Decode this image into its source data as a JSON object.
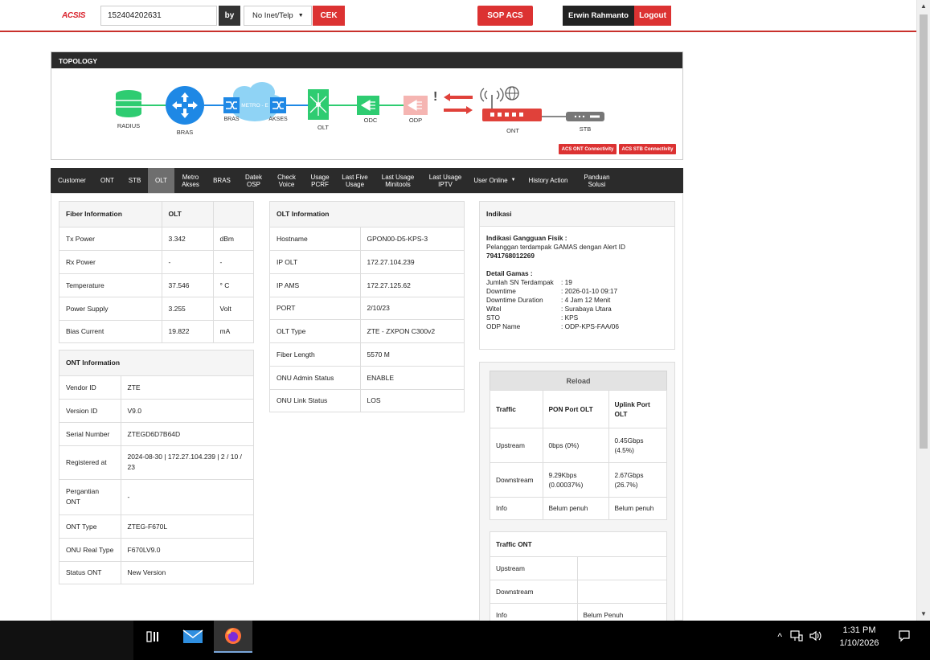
{
  "header": {
    "logo": "ACSIS",
    "search_value": "152404202631",
    "by_label": "by",
    "type_select": "No Inet/Telp",
    "cek_label": "CEK",
    "sop_label": "SOP ACS",
    "user_name": "Erwin Rahmanto",
    "logout_label": "Logout"
  },
  "topology": {
    "title": "TOPOLOGY",
    "nodes": {
      "radius": "RADIUS",
      "bras": "BRAS",
      "bras2": "BRAS",
      "metro": "METRO - E",
      "akses": "AKSES",
      "olt": "OLT",
      "odc": "ODC",
      "odp": "ODP",
      "ont": "ONT",
      "stb": "STB"
    },
    "alert_mark": "!",
    "btn_ont": "ACS ONT Connectivity",
    "btn_stb": "ACS STB Connectivity",
    "colors": {
      "green": "#2ecc71",
      "blue": "#1e88e5",
      "red": "#e0413a",
      "cloud": "#8fd3f5"
    }
  },
  "tabs": [
    {
      "label": "Customer"
    },
    {
      "label": "ONT"
    },
    {
      "label": "STB"
    },
    {
      "label": "OLT",
      "active": true
    },
    {
      "label": "Metro\nAkses"
    },
    {
      "label": "BRAS"
    },
    {
      "label": "Datek\nOSP"
    },
    {
      "label": "Check\nVoice"
    },
    {
      "label": "Usage\nPCRF"
    },
    {
      "label": "Last Five\nUsage"
    },
    {
      "label": "Last Usage\nMinitools"
    },
    {
      "label": "Last Usage\nIPTV"
    },
    {
      "label": "User Online",
      "dropdown": true
    },
    {
      "label": "History Action"
    },
    {
      "label": "Panduan\nSolusi"
    }
  ],
  "fiber": {
    "header": [
      "Fiber Information",
      "OLT",
      ""
    ],
    "rows": [
      [
        "Tx Power",
        "3.342",
        "dBm"
      ],
      [
        "Rx Power",
        "-",
        "-"
      ],
      [
        "Temperature",
        "37.546",
        "° C"
      ],
      [
        "Power Supply",
        "3.255",
        "Volt"
      ],
      [
        "Bias Current",
        "19.822",
        "mA"
      ]
    ]
  },
  "ont_info": {
    "title": "ONT Information",
    "rows": [
      [
        "Vendor ID",
        "ZTE"
      ],
      [
        "Version ID",
        "V9.0"
      ],
      [
        "Serial Number",
        "ZTEGD6D7B64D"
      ],
      [
        "Registered at",
        "2024-08-30 | 172.27.104.239 | 2 / 10 / 23"
      ],
      [
        "Pergantian ONT",
        "-"
      ],
      [
        "ONT Type",
        "ZTEG-F670L"
      ],
      [
        "ONU Real Type",
        "F670LV9.0"
      ],
      [
        "Status ONT",
        "New Version"
      ]
    ]
  },
  "olt_info": {
    "title": "OLT Information",
    "rows": [
      [
        "Hostname",
        "GPON00-D5-KPS-3"
      ],
      [
        "IP OLT",
        "172.27.104.239"
      ],
      [
        "IP AMS",
        "172.27.125.62"
      ],
      [
        "PORT",
        "2/10/23"
      ],
      [
        "OLT Type",
        "ZTE - ZXPON C300v2"
      ],
      [
        "Fiber Length",
        "5570 M"
      ],
      [
        "ONU Admin Status",
        "ENABLE"
      ],
      [
        "ONU Link Status",
        "LOS"
      ]
    ]
  },
  "indikasi": {
    "title": "Indikasi",
    "gangguan_title": "Indikasi Gangguan Fisik :",
    "gangguan_text": "Pelanggan terdampak GAMAS dengan Alert ID",
    "alert_id": "7941768012269",
    "detail_title": "Detail Gamas :",
    "details": [
      [
        "Jumlah SN Terdampak",
        ": 19"
      ],
      [
        "Downtime",
        ": 2026-01-10 09:17"
      ],
      [
        "Downtime Duration",
        ": 4 Jam 12 Menit"
      ],
      [
        "Witel",
        ": Surabaya Utara"
      ],
      [
        "STO",
        ": KPS"
      ],
      [
        "ODP Name",
        ": ODP-KPS-FAA/06"
      ]
    ]
  },
  "traffic": {
    "reload_label": "Reload",
    "header": [
      "Traffic",
      "PON Port OLT",
      "Uplink Port OLT"
    ],
    "rows": [
      [
        "Upstream",
        "0bps (0%)",
        "0.45Gbps (4.5%)"
      ],
      [
        "Downstream",
        "9.29Kbps (0.00037%)",
        "2.67Gbps (26.7%)"
      ],
      [
        "Info",
        "Belum penuh",
        "Belum penuh"
      ]
    ],
    "ont_title": "Traffic ONT",
    "ont_rows": [
      [
        "Upstream",
        ""
      ],
      [
        "Downstream",
        ""
      ],
      [
        "Info",
        "Belum Penuh"
      ]
    ]
  },
  "taskbar": {
    "time": "1:31 PM",
    "date": "1/10/2026"
  }
}
